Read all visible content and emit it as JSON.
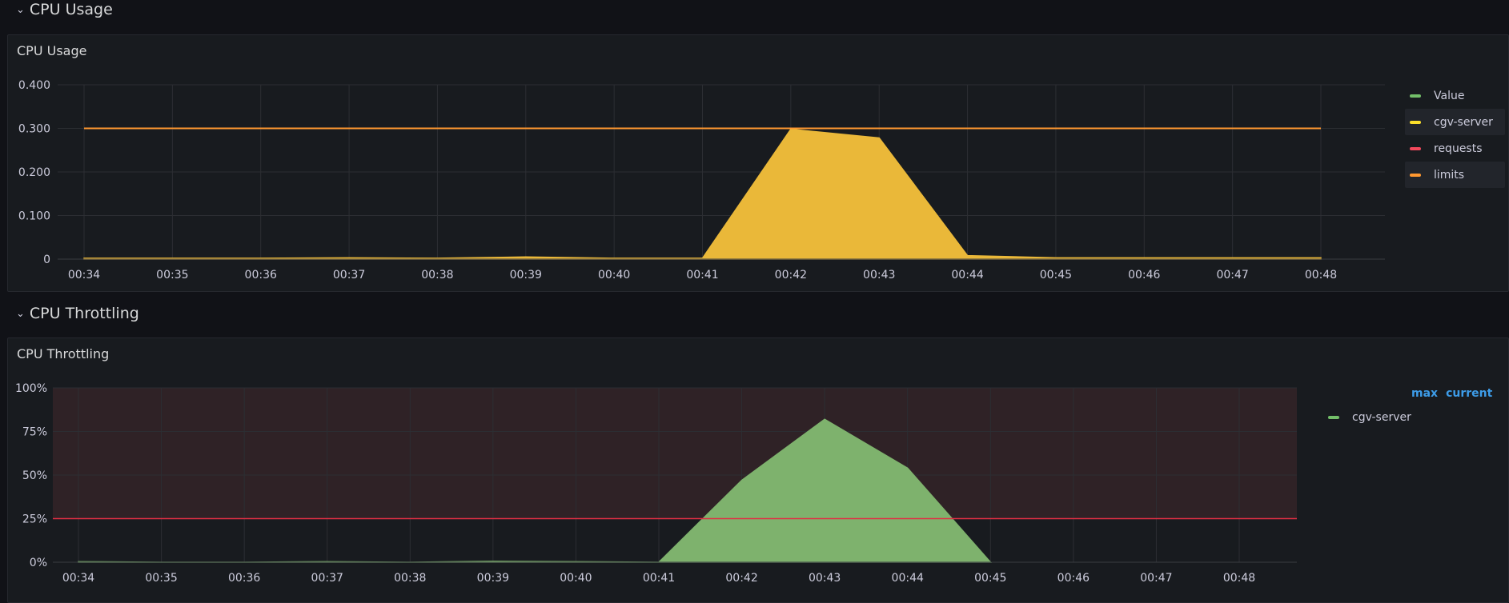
{
  "rows": [
    {
      "title": "CPU Usage",
      "chevron": "⌄"
    },
    {
      "title": "CPU Throttling",
      "chevron": "⌄"
    }
  ],
  "panels": [
    {
      "title": "CPU Usage",
      "legend": [
        {
          "label": "Value",
          "color": "#73bf69"
        },
        {
          "label": "cgv-server",
          "color": "#fade2a"
        },
        {
          "label": "requests",
          "color": "#f2495c"
        },
        {
          "label": "limits",
          "color": "#ff9830"
        }
      ]
    },
    {
      "title": "CPU Throttling",
      "legend_headers": [
        "max",
        "current"
      ],
      "legend": [
        {
          "label": "cgv-server",
          "color": "#73bf69"
        }
      ]
    }
  ],
  "chart_data": [
    {
      "type": "area",
      "title": "CPU Usage",
      "x": [
        "00:34",
        "00:35",
        "00:36",
        "00:37",
        "00:38",
        "00:39",
        "00:40",
        "00:41",
        "00:42",
        "00:43",
        "00:44",
        "00:45",
        "00:46",
        "00:47",
        "00:48"
      ],
      "yticks": [
        "0",
        "0.100",
        "0.200",
        "0.300",
        "0.400"
      ],
      "ylim": [
        0,
        0.4
      ],
      "grid": true,
      "legend_position": "right",
      "series": [
        {
          "name": "cgv-server",
          "type": "area",
          "color": "#eab839",
          "points": [
            [
              "00:34",
              0.002
            ],
            [
              "00:35",
              0.002
            ],
            [
              "00:36",
              0.002
            ],
            [
              "00:37",
              0.003
            ],
            [
              "00:38",
              0.002
            ],
            [
              "00:39",
              0.005
            ],
            [
              "00:40",
              0.002
            ],
            [
              "00:41",
              0.002
            ],
            [
              "00:42",
              0.298
            ],
            [
              "00:43",
              0.278
            ],
            [
              "00:44",
              0.008
            ],
            [
              "00:45",
              0.003
            ],
            [
              "00:46",
              0.003
            ],
            [
              "00:47",
              0.003
            ],
            [
              "00:48",
              0.003
            ]
          ]
        },
        {
          "name": "limits",
          "type": "line",
          "color": "#ff9830",
          "points": [
            [
              "00:34",
              0.3
            ],
            [
              "00:48",
              0.3
            ]
          ]
        }
      ]
    },
    {
      "type": "area",
      "title": "CPU Throttling",
      "x": [
        "00:34",
        "00:35",
        "00:36",
        "00:37",
        "00:38",
        "00:39",
        "00:40",
        "00:41",
        "00:42",
        "00:43",
        "00:44",
        "00:45",
        "00:46",
        "00:47",
        "00:48"
      ],
      "yticks": [
        "0%",
        "25%",
        "50%",
        "75%",
        "100%"
      ],
      "ylim": [
        0,
        100
      ],
      "grid": true,
      "legend_position": "right",
      "threshold": {
        "value": 25,
        "color": "#e02f44",
        "region_above_color": "#2f2226"
      },
      "series": [
        {
          "name": "cgv-server",
          "type": "area",
          "color": "#7eb26d",
          "points": [
            [
              "00:34",
              0.3
            ],
            [
              "00:35",
              0
            ],
            [
              "00:36",
              0
            ],
            [
              "00:37",
              0.3
            ],
            [
              "00:38",
              0
            ],
            [
              "00:39",
              0.5
            ],
            [
              "00:40",
              0.3
            ],
            [
              "00:41",
              0
            ],
            [
              "00:42",
              47
            ],
            [
              "00:43",
              82
            ],
            [
              "00:44",
              54
            ],
            [
              "00:45",
              0
            ]
          ]
        }
      ]
    }
  ]
}
